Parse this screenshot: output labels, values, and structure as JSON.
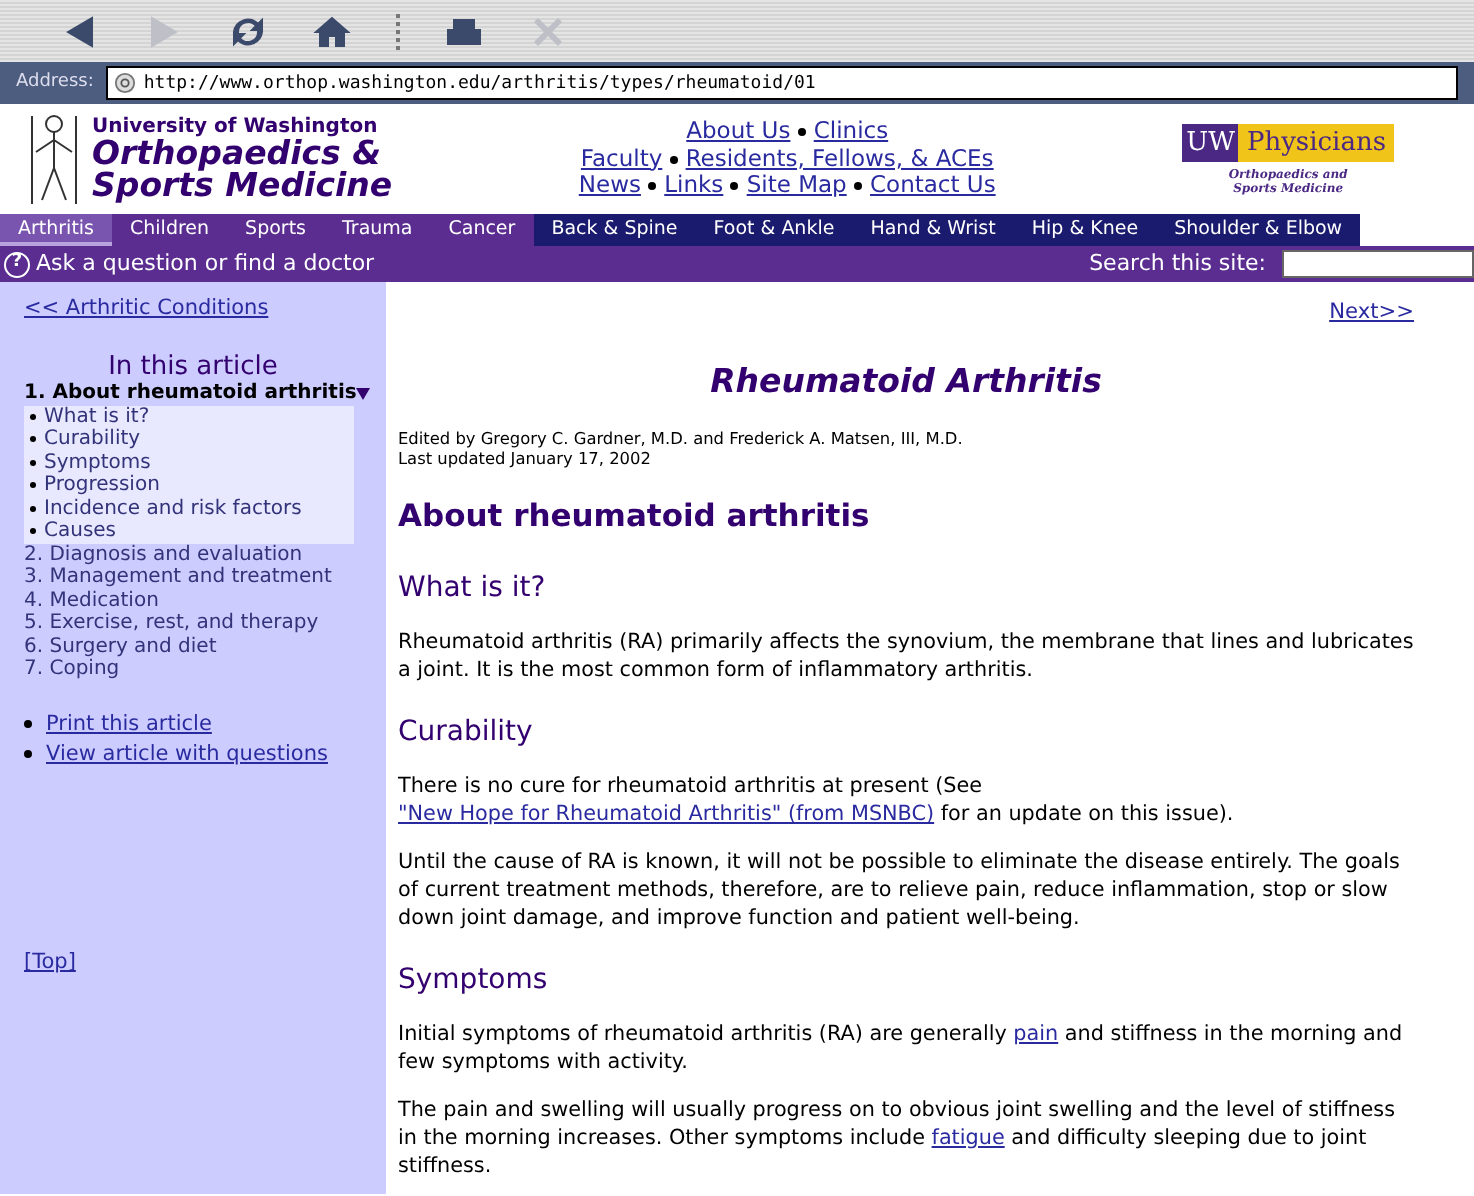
{
  "toolbar": {
    "buttons": [
      {
        "kind": "back",
        "disabled": false
      },
      {
        "kind": "forward",
        "disabled": true
      },
      {
        "kind": "reload",
        "disabled": false
      },
      {
        "kind": "home",
        "disabled": false
      },
      {
        "kind": "print",
        "disabled": false
      },
      {
        "kind": "stop",
        "disabled": true
      }
    ]
  },
  "address_bar": {
    "label": "Address:",
    "value": "http://www.orthop.washington.edu/arthritis/types/rheumatoid/01"
  },
  "header": {
    "logo_line1": "University of Washington",
    "logo_line2": "Orthopaedics &",
    "logo_line3": "Sports Medicine",
    "links": [
      [
        "About Us",
        "Clinics"
      ],
      [
        "Faculty",
        "Residents, Fellows, & ACEs"
      ],
      [
        "News",
        "Links",
        "Site Map",
        "Contact Us"
      ]
    ],
    "partner_logo": {
      "mark": "UW",
      "name": "Physicians",
      "caption": "Orthopaedics and Sports Medicine"
    }
  },
  "nav": [
    {
      "label": "Arthritis",
      "selected": true,
      "color": "#7a55b0"
    },
    {
      "label": "Children",
      "selected": false,
      "color": "#5c2d91"
    },
    {
      "label": "Sports",
      "selected": false,
      "color": "#5c2d91"
    },
    {
      "label": "Trauma",
      "selected": false,
      "color": "#5c2d91"
    },
    {
      "label": "Cancer",
      "selected": false,
      "color": "#5c2d91"
    },
    {
      "label": "Back & Spine",
      "selected": false,
      "color": "#1a1a6e"
    },
    {
      "label": "Foot & Ankle",
      "selected": false,
      "color": "#1a1a6e"
    },
    {
      "label": "Hand & Wrist",
      "selected": false,
      "color": "#1a1a6e"
    },
    {
      "label": "Hip & Knee",
      "selected": false,
      "color": "#1a1a6e"
    },
    {
      "label": "Shoulder & Elbow",
      "selected": false,
      "color": "#1a1a6e"
    }
  ],
  "ask_bar": {
    "help_glyph": "?",
    "text": "Ask a question or find a doctor",
    "search_label": "Search this site:"
  },
  "sidebar": {
    "back_link": "<< Arthritic Conditions",
    "heading": "In this article",
    "items": [
      {
        "label": "1. About rheumatoid arthritis",
        "selected": true,
        "expanded": true,
        "children": [
          {
            "label": "What is it?"
          },
          {
            "label": "Curability"
          },
          {
            "label": "Symptoms"
          },
          {
            "label": "Progression"
          },
          {
            "label": "Incidence and risk factors"
          },
          {
            "label": "Causes"
          }
        ]
      },
      {
        "label": "2. Diagnosis and evaluation",
        "selected": false,
        "expanded": false
      },
      {
        "label": "3. Management and treatment",
        "selected": false,
        "expanded": false
      },
      {
        "label": "4. Medication",
        "selected": false,
        "expanded": false
      },
      {
        "label": "5. Exercise, rest, and therapy",
        "selected": false,
        "expanded": false
      },
      {
        "label": "6. Surgery and diet",
        "selected": false,
        "expanded": false
      },
      {
        "label": "7. Coping",
        "selected": false,
        "expanded": false
      }
    ],
    "actions": [
      "Print this article",
      "View article with questions"
    ],
    "top_link": "[Top]"
  },
  "article": {
    "next_link": "Next>>",
    "title": "Rheumatoid Arthritis",
    "byline": "Edited by Gregory C. Gardner, M.D. and Frederick A. Matsen, III, M.D.",
    "updated": "Last updated January 17, 2002",
    "heading": "About rheumatoid arthritis",
    "sections": [
      {
        "heading": "What is it?",
        "paragraphs": [
          [
            {
              "kind": "text",
              "text": "Rheumatoid arthritis (RA) primarily affects the synovium, the membrane that lines and lubricates a joint. It is the most common form of inflammatory arthritis."
            }
          ]
        ]
      },
      {
        "heading": "Curability",
        "paragraphs": [
          [
            {
              "kind": "text",
              "text": "There is no cure for rheumatoid arthritis at present (See "
            },
            {
              "kind": "link",
              "text": "\"New Hope for Rheumatoid Arthritis\" (from MSNBC)"
            },
            {
              "kind": "text",
              "text": " for an update on this issue)."
            }
          ],
          [
            {
              "kind": "text",
              "text": "Until the cause of RA is known, it will not be possible to eliminate the disease entirely. The goals of current treatment methods, therefore, are to relieve pain, reduce inflammation, stop or slow down joint damage, and improve function and patient well-being."
            }
          ]
        ]
      },
      {
        "heading": "Symptoms",
        "paragraphs": [
          [
            {
              "kind": "text",
              "text": "Initial symptoms of rheumatoid arthritis (RA) are generally "
            },
            {
              "kind": "link",
              "text": "pain"
            },
            {
              "kind": "text",
              "text": " and stiffness in the morning and few symptoms with activity."
            }
          ],
          [
            {
              "kind": "text",
              "text": "The pain and swelling will usually progress on to obvious joint swelling and the level of stiffness in the morning increases. Other symptoms include "
            },
            {
              "kind": "link",
              "text": "fatigue"
            },
            {
              "kind": "text",
              "text": " and difficulty sleeping due to joint stiffness."
            }
          ]
        ]
      }
    ]
  }
}
